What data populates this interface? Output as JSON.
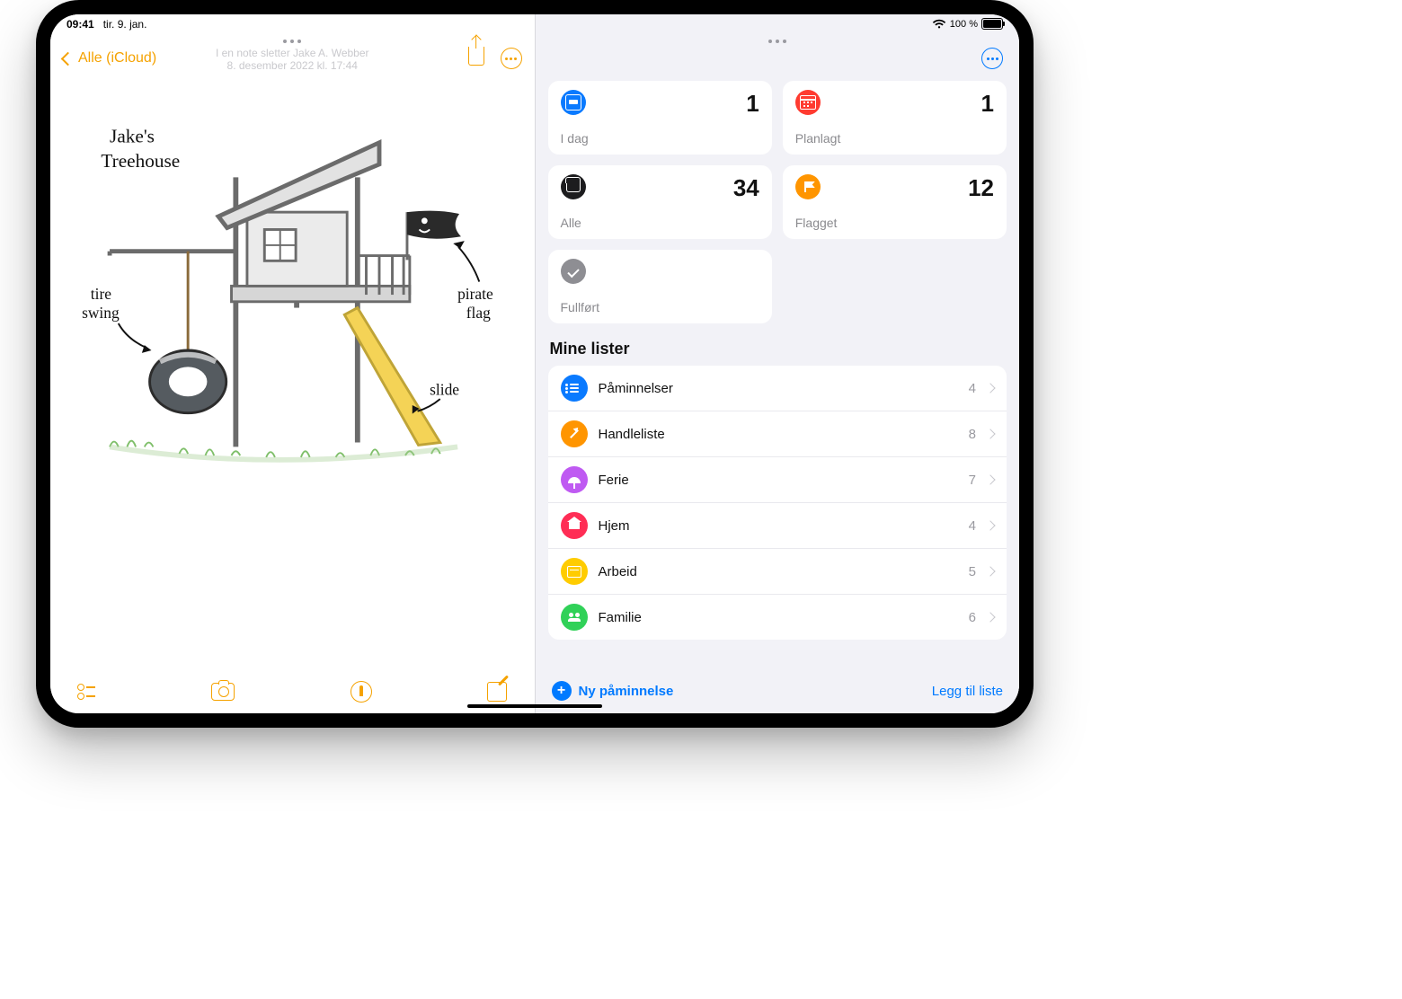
{
  "statusbar": {
    "time": "09:41",
    "date": "tir. 9. jan.",
    "battery_pct": "100 %"
  },
  "notes": {
    "back_label": "Alle (iCloud)",
    "subtitle_line1": "I en note sletter Jake A. Webber",
    "subtitle_line2": "8. desember 2022 kl. 17:44",
    "annotations": {
      "title1": "Jake's",
      "title2": "Treehouse",
      "tire1": "tire",
      "tire2": "swing",
      "pirate1": "pirate",
      "pirate2": "flag",
      "slide": "slide"
    }
  },
  "reminders": {
    "cards": {
      "today": {
        "label": "I dag",
        "count": "1"
      },
      "planned": {
        "label": "Planlagt",
        "count": "1"
      },
      "all": {
        "label": "Alle",
        "count": "34"
      },
      "flagged": {
        "label": "Flagget",
        "count": "12"
      },
      "done": {
        "label": "Fullført"
      }
    },
    "section_title": "Mine lister",
    "lists": [
      {
        "name": "Påminnelser",
        "count": "4",
        "color": "#0a7aff",
        "glyph": "bullets"
      },
      {
        "name": "Handleliste",
        "count": "8",
        "color": "#ff9500",
        "glyph": "carrot"
      },
      {
        "name": "Ferie",
        "count": "7",
        "color": "#bf5af2",
        "glyph": "umbrella"
      },
      {
        "name": "Hjem",
        "count": "4",
        "color": "#ff2d55",
        "glyph": "house"
      },
      {
        "name": "Arbeid",
        "count": "5",
        "color": "#ffcc00",
        "glyph": "book"
      },
      {
        "name": "Familie",
        "count": "6",
        "color": "#30d158",
        "glyph": "people"
      }
    ],
    "new_reminder": "Ny påminnelse",
    "add_list": "Legg til liste"
  }
}
